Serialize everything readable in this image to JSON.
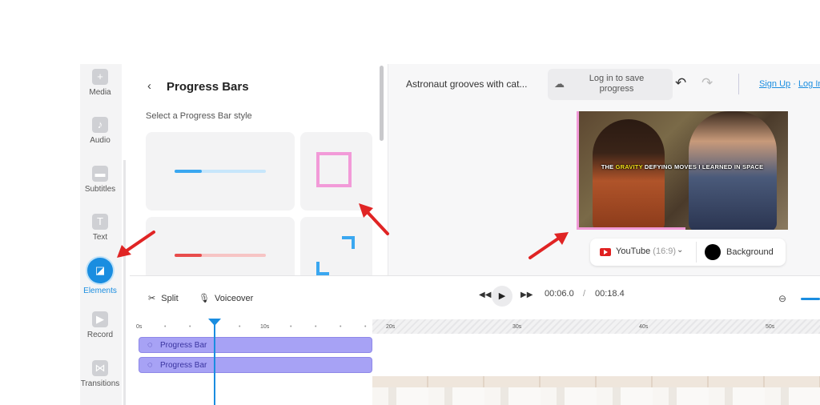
{
  "sidebar": {
    "items": [
      {
        "label": "Media",
        "icon": "plus-icon"
      },
      {
        "label": "Audio",
        "icon": "music-note-icon"
      },
      {
        "label": "Subtitles",
        "icon": "subtitles-icon"
      },
      {
        "label": "Text",
        "icon": "text-icon"
      },
      {
        "label": "Elements",
        "icon": "elements-icon",
        "active": true
      },
      {
        "label": "Record",
        "icon": "record-icon"
      },
      {
        "label": "Transitions",
        "icon": "transitions-icon"
      }
    ]
  },
  "panel": {
    "title": "Progress Bars",
    "subtitle": "Select a Progress Bar style",
    "styles": [
      {
        "name": "linear-blue",
        "color": "#3aa7f0"
      },
      {
        "name": "square-pink",
        "color": "#f29ad8"
      },
      {
        "name": "linear-red",
        "color": "#e84c4c"
      },
      {
        "name": "corners-blue",
        "color": "#3aa7f0"
      }
    ]
  },
  "header": {
    "project_title": "Astronaut grooves with cat...",
    "save_text": "Log in to save progress",
    "sign_up": "Sign Up",
    "separator": "·",
    "log_in": "Log In"
  },
  "preview": {
    "caption_before": "THE ",
    "caption_highlight": "GRAVITY",
    "caption_after": " DEFYING MOVES I LEARNED IN SPACE",
    "format_label": "YouTube",
    "format_ratio": "(16:9)",
    "background_label": "Background",
    "background_color": "#000000",
    "progress_bar_color": "#f29ad8"
  },
  "timeline": {
    "split_label": "Split",
    "voiceover_label": "Voiceover",
    "current_time": "00:06.0",
    "time_separator": "/",
    "total_time": "00:18.4",
    "ruler_ticks": [
      "0s",
      "10s",
      "20s",
      "30s",
      "40s",
      "50s"
    ],
    "tracks": [
      {
        "label": "Progress Bar"
      },
      {
        "label": "Progress Bar"
      }
    ],
    "accent_color": "#1a8de0",
    "track_color": "#a7a2f5"
  }
}
